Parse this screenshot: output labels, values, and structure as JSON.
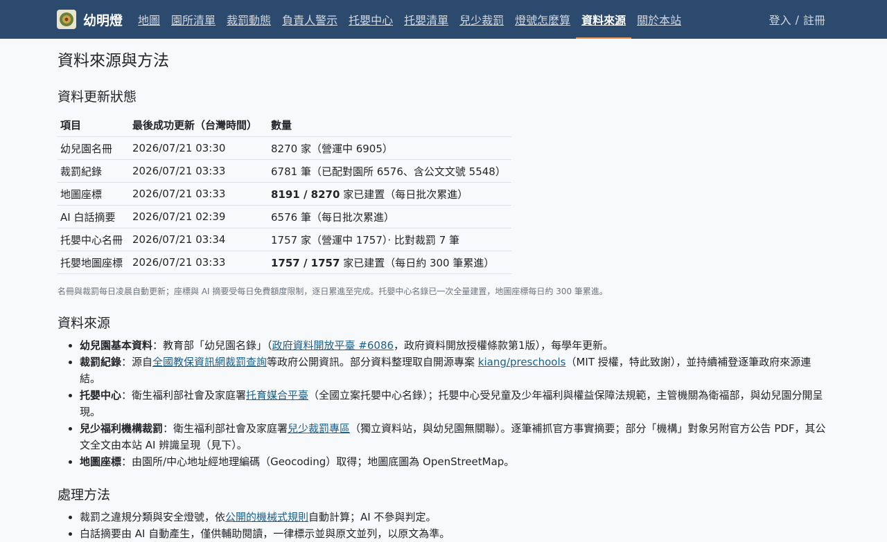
{
  "nav": {
    "brand": "幼明燈",
    "brand_icon": "brand-logo-icon",
    "items": [
      "地圖",
      "園所清單",
      "裁罰動態",
      "負責人警示",
      "托嬰中心",
      "托嬰清單",
      "兒少裁罰",
      "燈號怎麼算",
      "資料來源",
      "關於本站"
    ],
    "active_index": 8,
    "login": "登入",
    "separator": "/",
    "register": "註冊"
  },
  "page": {
    "title": "資料來源與方法"
  },
  "status": {
    "heading": "資料更新狀態",
    "columns": [
      "項目",
      "最後成功更新（台灣時間）",
      "數量"
    ],
    "rows": [
      {
        "item": "幼兒園名冊",
        "updated": "2026/07/21 03:30",
        "count_bold": "",
        "count": "8270 家（營運中 6905）"
      },
      {
        "item": "裁罰紀錄",
        "updated": "2026/07/21 03:33",
        "count_bold": "",
        "count": "6781 筆（已配對園所 6576、含公文文號 5548）"
      },
      {
        "item": "地圖座標",
        "updated": "2026/07/21 03:33",
        "count_bold": "8191 / 8270",
        "count": " 家已建置（每日批次累進）"
      },
      {
        "item": "AI 白話摘要",
        "updated": "2026/07/21 02:39",
        "count_bold": "",
        "count": "6576 筆（每日批次累進）"
      },
      {
        "item": "托嬰中心名冊",
        "updated": "2026/07/21 03:34",
        "count_bold": "",
        "count": "1757 家（營運中 1757）· 比對裁罰 7 筆"
      },
      {
        "item": "托嬰地圖座標",
        "updated": "2026/07/21 03:33",
        "count_bold": "1757 / 1757",
        "count": " 家已建置（每日約 300 筆累進）"
      }
    ],
    "note": "名冊與裁罰每日凌晨自動更新；座標與 AI 摘要受每日免費額度限制，逐日累進至完成。托嬰中心名錄已一次全量建置，地圖座標每日約 300 筆累進。"
  },
  "sources": {
    "heading": "資料來源",
    "items": [
      {
        "label": "幼兒園基本資料",
        "pre": "：教育部「幼兒園名錄」（",
        "link": "政府資料開放平臺 #6086",
        "post": "，政府資料開放授權條款第1版），每學年更新。"
      },
      {
        "label": "裁罰紀錄",
        "pre": "：源自",
        "link": "全國教保資訊網裁罰查詢",
        "mid": "等政府公開資訊。部分資料整理取自開源專案 ",
        "link2": "kiang/preschools",
        "post": "（MIT 授權，特此致謝），並持續補登逐筆政府來源連結。"
      },
      {
        "label": "托嬰中心",
        "pre": "：衛生福利部社會及家庭署",
        "link": "托育媒合平臺",
        "post": "（全國立案托嬰中心名錄）；托嬰中心受兒童及少年福利與權益保障法規範，主管機關為衛福部，與幼兒園分開呈現。"
      },
      {
        "label": "兒少福利機構裁罰",
        "pre": "：衛生福利部社會及家庭署",
        "link": "兒少裁罰專區",
        "post": "（獨立資料站，與幼兒園無關聯）。逐筆補抓官方事實摘要；部分「機構」對象另附官方公告 PDF，其公文全文由本站 AI 辨識呈現（見下）。"
      },
      {
        "label": "地圖座標",
        "pre": "：由園所/中心地址經地理編碼（Geocoding）取得；地圖底圖為 OpenStreetMap。",
        "link": "",
        "post": ""
      }
    ]
  },
  "methods": {
    "heading": "處理方法",
    "items": [
      {
        "pre": "裁罰之違規分類與安全燈號，依",
        "link": "公開的機械式規則",
        "post": "自動計算；AI 不參與判定。"
      },
      {
        "pre": "白話摘要由 AI 自動產生，僅供輔助閱讀，一律標示並與原文並列，以原文為準。",
        "link": "",
        "post": ""
      }
    ]
  },
  "colors": {
    "navbar": "#2c4a6e",
    "active_underline": "#e8934a",
    "link": "#1a5f8a"
  }
}
